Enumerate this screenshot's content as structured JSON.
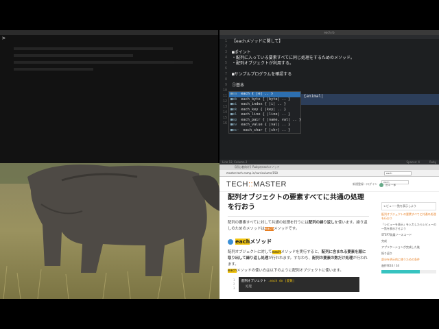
{
  "terminal": {
    "prompt": ">"
  },
  "editor": {
    "title": "each.rb",
    "lines": [
      {
        "num": "1",
        "text": "【eachメソッドに関して】"
      },
      {
        "num": "2",
        "text": ""
      },
      {
        "num": "3",
        "text": "■ポイント"
      },
      {
        "num": "4",
        "text": "・配列に入っている要素すべてに同じ処理をするためのメソッド。"
      },
      {
        "num": "5",
        "text": "・配列オブジェクトが利用する。"
      },
      {
        "num": "6",
        "text": ""
      },
      {
        "num": "7",
        "text": "■サンプルプログラムを確認する"
      },
      {
        "num": "8",
        "text": ""
      },
      {
        "num": "9",
        "text": "①基本"
      },
      {
        "num": "10",
        "text": ""
      },
      {
        "num": "11",
        "text": "[\"dog\", \"cat\", \"mouse\"].each {animal|"
      },
      {
        "num": "12",
        "text": "d"
      },
      {
        "num": "13",
        "text": ""
      },
      {
        "num": "14",
        "text": ""
      },
      {
        "num": "15",
        "text": ""
      },
      {
        "num": "16",
        "text": ""
      }
    ],
    "status_left": "Line 12, Column 2",
    "status_right_1": "Spaces: 4",
    "status_right_2": "Ruby"
  },
  "autocomplete": [
    {
      "tag": "■ea",
      "text": "each { |e| .. }"
    },
    {
      "tag": "■eb",
      "text": "each_byte { |byte| .. }"
    },
    {
      "tag": "■ei",
      "text": "each_index { |i| .. }"
    },
    {
      "tag": "■ek",
      "text": "each_key { |key| .. }"
    },
    {
      "tag": "■el",
      "text": "each_line { |line| .. }"
    },
    {
      "tag": "■ep",
      "text": "each_pair { |name, val| .. }"
    },
    {
      "tag": "■ev",
      "text": "each_value { |val| .. }"
    },
    {
      "tag": "■ec-",
      "text": "each_char { |chr| .. }"
    }
  ],
  "browser": {
    "tab_title": "【初心者向け】Rubyのeachメソッド",
    "url": "master.tech-camp.in/curriculums/158",
    "search": "each",
    "logo_a": "TECH",
    "logo_b": "::",
    "logo_c": "MASTER",
    "intro": "新規登録・ログイン",
    "searchbox": "each",
    "user": "田中 一郎",
    "article": {
      "title": "配列オブジェクトの要素すべてに共通の処理を行おう",
      "p1_a": "配列の要素すべてに対して共通の処理を行うには",
      "p1_b": "配列の繰り返し",
      "p1_c": "を使います。繰り返しのためのメソッドは",
      "p1_d": "each",
      "p1_e": "メソッドです。",
      "h2_hl": "each",
      "h2_text": "メソッド",
      "p2_a": "配列オブジェクトに対して",
      "p2_b": "each",
      "p2_c": "メソッドを実行すると、",
      "p2_d": "配列に含まれる要素を順に取り出して繰り返し処理",
      "p2_e": "が行われます。すなわち、",
      "p2_f": "配列の要素の数だけ処理",
      "p2_g": "が行われます。",
      "p3_a": "each",
      "p3_b": "メソッドの使い方は以下のように配列オブジェクトに使います。",
      "code_nums": "1\n2\n3",
      "code_a": "配列オブジェクト",
      "code_b": ".each do |変数|",
      "code_c": "処理"
    },
    "sidebar": {
      "box": "レビュー一覧を表示しよう",
      "items": [
        "配列オブジェクトの要素すべてに共通の処理を行おう",
        "「レビューを表示」を入力したらレビューの一覧を表示させよう",
        "STEP7発展ソースコード",
        "完成",
        "アプリケーションが完成した後",
        "振り返り"
      ],
      "bottom_label": "部分を明示的に使うための条件",
      "progress_label": "進捗率24 / 34",
      "progress": 0.7
    }
  }
}
